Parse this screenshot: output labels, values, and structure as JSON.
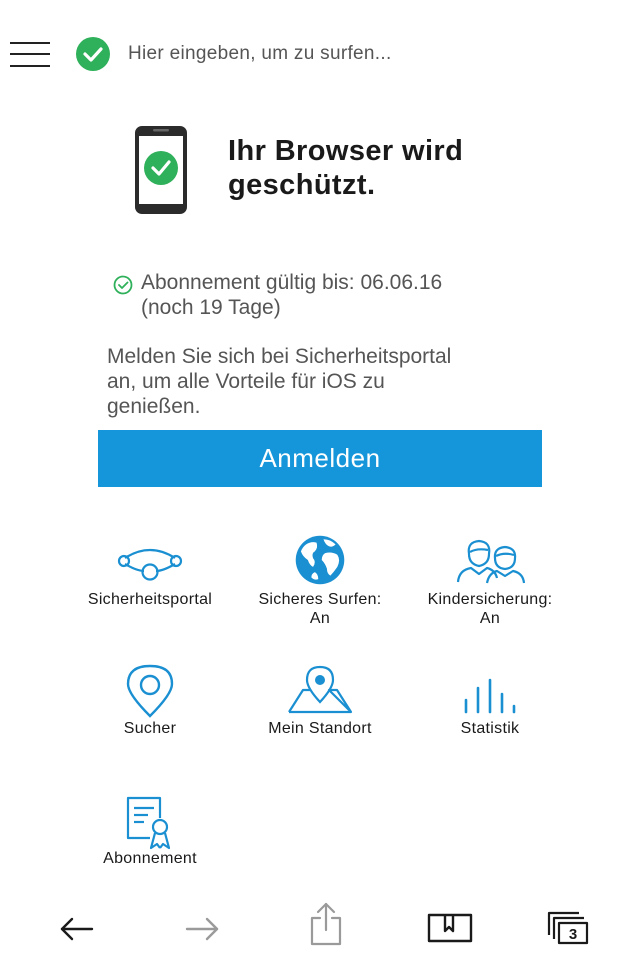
{
  "address_bar": {
    "placeholder": "Hier eingeben, um zu surfen..."
  },
  "hero": {
    "title_line1": "Ihr Browser wird",
    "title_line2": "geschützt."
  },
  "subscription": {
    "line1": "Abonnement gültig bis: 06.06.16",
    "line2": "(noch 19 Tage)"
  },
  "info": {
    "line1": "Melden Sie sich bei Sicherheitsportal",
    "line2": "an, um alle Vorteile für iOS zu",
    "line3": "genießen."
  },
  "login_button": "Anmelden",
  "features": [
    {
      "label": "Sicherheitsportal",
      "icon": "security-portal-icon"
    },
    {
      "label": "Sicheres Surfen:\nAn",
      "icon": "globe-icon"
    },
    {
      "label": "Kindersicherung:\nAn",
      "icon": "family-icon"
    },
    {
      "label": "Sucher",
      "icon": "location-pin-icon"
    },
    {
      "label": "Mein Standort",
      "icon": "map-location-icon"
    },
    {
      "label": "Statistik",
      "icon": "statistics-icon"
    },
    {
      "label": "Abonnement",
      "icon": "certificate-icon"
    }
  ],
  "toolbar": {
    "tabs_count": "3"
  },
  "colors": {
    "accent": "#1596db",
    "success": "#2fb05a",
    "icon_blue": "#1a8fd1"
  }
}
